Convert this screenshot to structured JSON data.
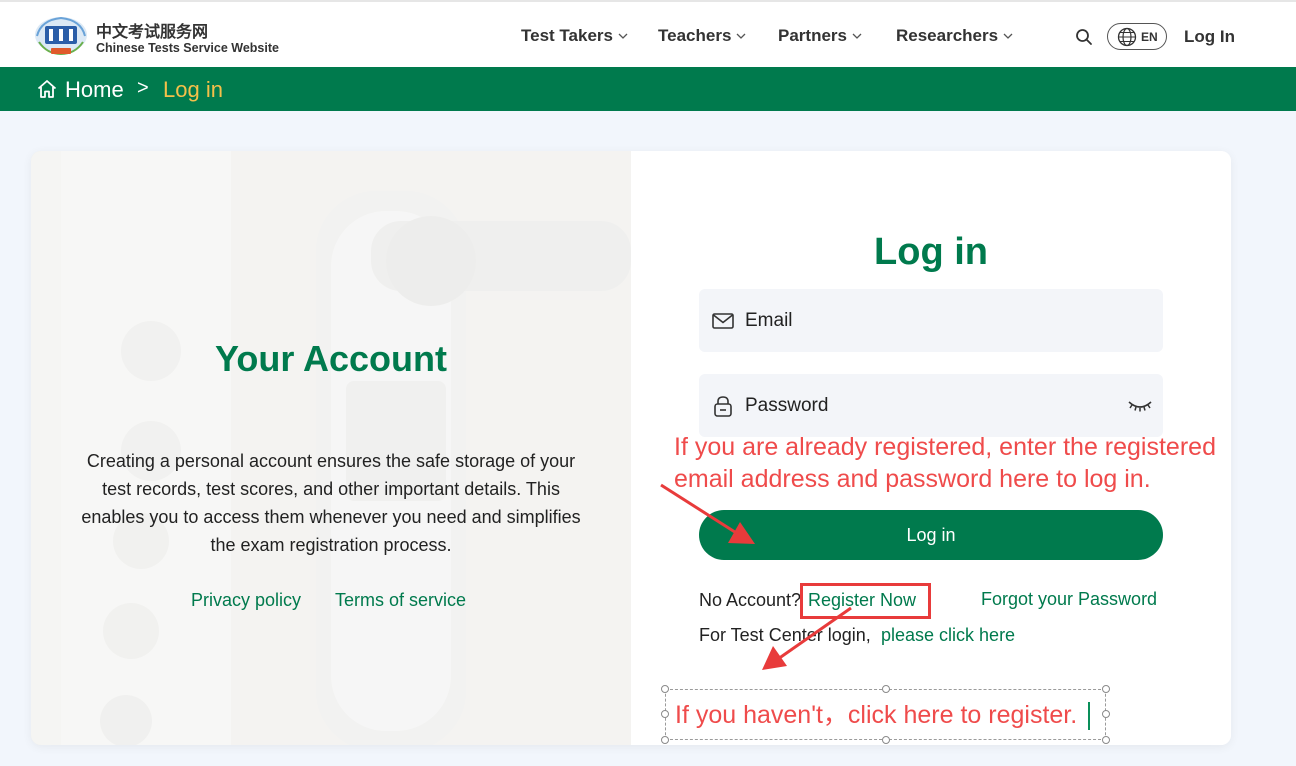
{
  "header": {
    "logo_cn": "中文考试服务网",
    "logo_en": "Chinese Tests Service Website",
    "nav": [
      {
        "label": "Test Takers"
      },
      {
        "label": "Teachers"
      },
      {
        "label": "Partners"
      },
      {
        "label": "Researchers"
      }
    ],
    "lang": "EN",
    "login": "Log In",
    "icons": [
      "logo-emblem-icon",
      "chevron-down-icon",
      "search-icon",
      "globe-icon"
    ]
  },
  "breadcrumb": {
    "home": "Home",
    "separator": ">",
    "current": "Log in",
    "home_icon": "home-icon"
  },
  "left_panel": {
    "title": "Your Account",
    "description": "Creating a personal account ensures the safe storage of your test records, test scores, and other important details. This enables you to access them whenever you need and simplifies the exam registration process.",
    "privacy": "Privacy policy",
    "terms": "Terms of service"
  },
  "login_form": {
    "title": "Log in",
    "email_placeholder": "Email",
    "password_placeholder": "Password",
    "submit": "Log in",
    "no_account": "No Account?",
    "register": "Register Now",
    "forgot": "Forgot your Password",
    "test_center_text": "For Test Center login,",
    "test_center_link": "please click here",
    "icons": [
      "mail-icon",
      "lock-icon",
      "eye-closed-icon"
    ]
  },
  "annotations": {
    "note1": "If you  are already  registered, enter the registered email address and password here to log in.",
    "note2": "If you haven't，click here to register."
  },
  "colors": {
    "brand_green": "#007a4d",
    "breadcrumb_active": "#f4c04a",
    "annotation_red": "#ef4b4b",
    "page_bg": "#f2f6fc"
  }
}
